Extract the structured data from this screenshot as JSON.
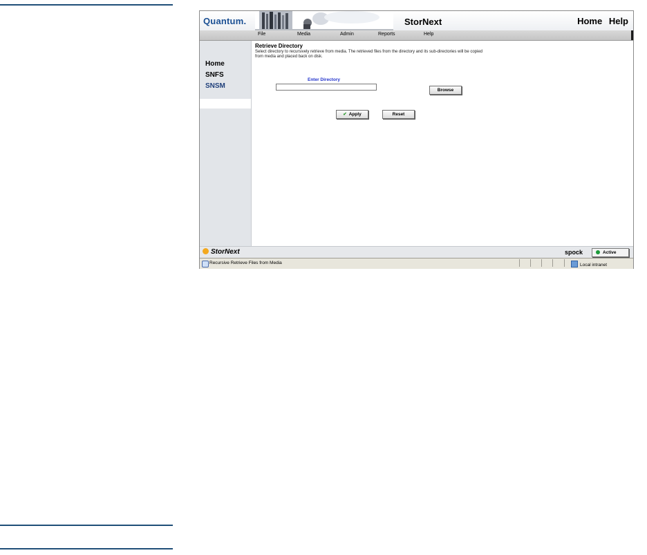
{
  "banner": {
    "logo": "Quantum",
    "logo_dot": ".",
    "title": "StorNext",
    "links": [
      "Home",
      "Help"
    ]
  },
  "menu": [
    "File",
    "Media",
    "Admin",
    "Reports",
    "Help"
  ],
  "sidebar": {
    "items": [
      "Home",
      "SNFS",
      "SNSM"
    ],
    "active": "SNSM"
  },
  "main": {
    "title": "Retrieve Directory",
    "description": "Select directory to recursively retrieve from media. The retrieved files from the directory and its sub-directories will be copied from media and placed back on disk.",
    "field_label": "Enter Directory",
    "field_value": "",
    "browse_label": "Browse",
    "apply_label": "Apply",
    "reset_label": "Reset"
  },
  "footer": {
    "logo": "StorNext",
    "hostname": "spock",
    "status": "Active"
  },
  "statusbar": {
    "text": "Recursive Retrieve Files from Media",
    "zone": "Local intranet"
  }
}
